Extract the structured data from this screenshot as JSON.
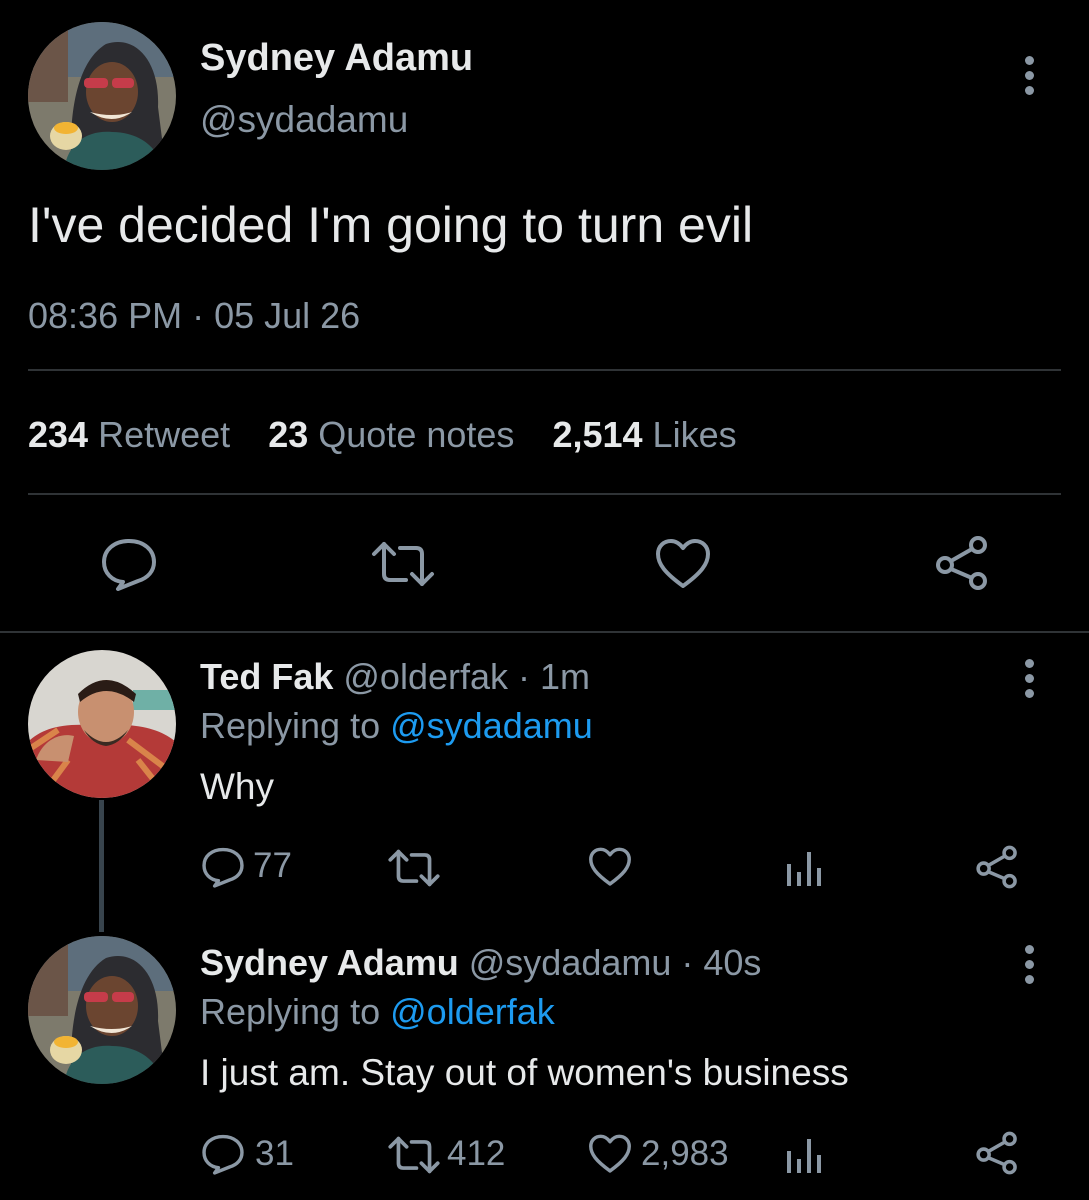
{
  "main_tweet": {
    "author_name": "Sydney Adamu",
    "author_handle": "@sydadamu",
    "text": "I've decided I'm going to turn evil",
    "timestamp": "08:36 PM · 05 Jul 26",
    "stats": {
      "retweets": "234",
      "retweets_label": "Retweet",
      "quotes": "23",
      "quotes_label": "Quote notes",
      "likes": "2,514",
      "likes_label": "Likes"
    }
  },
  "replies": [
    {
      "author_name": "Ted Fak",
      "meta": "@olderfak · 1m",
      "replying_prefix": "Replying to",
      "replying_to": "@sydadamu",
      "text": "Why",
      "reply_count": "77",
      "retweet_count": "",
      "like_count": ""
    },
    {
      "author_name": "Sydney Adamu",
      "meta": "@sydadamu · 40s",
      "replying_prefix": "Replying to",
      "replying_to": "@olderfak",
      "text": "I just am. Stay out of women's business",
      "reply_count": "31",
      "retweet_count": "412",
      "like_count": "2,983"
    }
  ],
  "colors": {
    "background": "#000000",
    "text": "#e7e9ea",
    "muted": "#8b98a5",
    "link": "#1d9bf0",
    "divider": "#2f3336"
  },
  "icons": {
    "reply": "comment-bubble-icon",
    "retweet": "retweet-arrows-icon",
    "like": "heart-icon",
    "share": "share-nodes-icon",
    "analytics": "bar-chart-icon",
    "more": "vertical-ellipsis-icon"
  }
}
